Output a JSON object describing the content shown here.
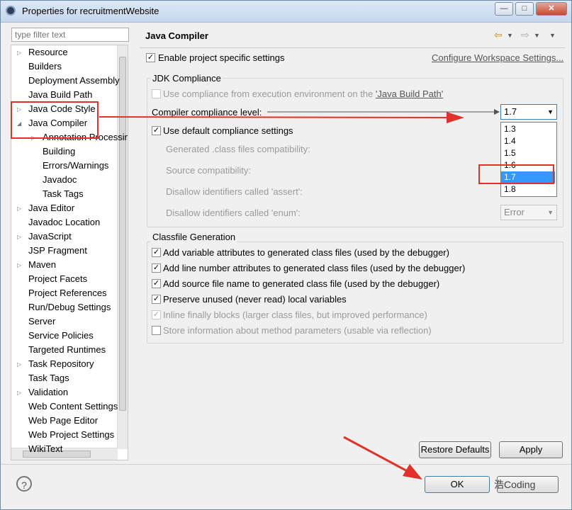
{
  "window": {
    "title": "Properties for recruitmentWebsite",
    "min": "—",
    "max": "□",
    "close": "✕"
  },
  "filter": {
    "placeholder": "type filter text"
  },
  "tree": [
    {
      "label": "Resource",
      "level": 0,
      "expander": "▷"
    },
    {
      "label": "Builders",
      "level": 0,
      "expander": ""
    },
    {
      "label": "Deployment Assembly",
      "level": 0,
      "expander": ""
    },
    {
      "label": "Java Build Path",
      "level": 0,
      "expander": ""
    },
    {
      "label": "Java Code Style",
      "level": 0,
      "expander": "▷"
    },
    {
      "label": "Java Compiler",
      "level": 0,
      "expander": "◢"
    },
    {
      "label": "Annotation Processing",
      "level": 1,
      "expander": "▷"
    },
    {
      "label": "Building",
      "level": 1,
      "expander": ""
    },
    {
      "label": "Errors/Warnings",
      "level": 1,
      "expander": ""
    },
    {
      "label": "Javadoc",
      "level": 1,
      "expander": ""
    },
    {
      "label": "Task Tags",
      "level": 1,
      "expander": ""
    },
    {
      "label": "Java Editor",
      "level": 0,
      "expander": "▷"
    },
    {
      "label": "Javadoc Location",
      "level": 0,
      "expander": ""
    },
    {
      "label": "JavaScript",
      "level": 0,
      "expander": "▷"
    },
    {
      "label": "JSP Fragment",
      "level": 0,
      "expander": ""
    },
    {
      "label": "Maven",
      "level": 0,
      "expander": "▷"
    },
    {
      "label": "Project Facets",
      "level": 0,
      "expander": ""
    },
    {
      "label": "Project References",
      "level": 0,
      "expander": ""
    },
    {
      "label": "Run/Debug Settings",
      "level": 0,
      "expander": ""
    },
    {
      "label": "Server",
      "level": 0,
      "expander": ""
    },
    {
      "label": "Service Policies",
      "level": 0,
      "expander": ""
    },
    {
      "label": "Targeted Runtimes",
      "level": 0,
      "expander": ""
    },
    {
      "label": "Task Repository",
      "level": 0,
      "expander": "▷"
    },
    {
      "label": "Task Tags",
      "level": 0,
      "expander": ""
    },
    {
      "label": "Validation",
      "level": 0,
      "expander": "▷"
    },
    {
      "label": "Web Content Settings",
      "level": 0,
      "expander": ""
    },
    {
      "label": "Web Page Editor",
      "level": 0,
      "expander": ""
    },
    {
      "label": "Web Project Settings",
      "level": 0,
      "expander": ""
    },
    {
      "label": "WikiText",
      "level": 0,
      "expander": ""
    }
  ],
  "page": {
    "title": "Java Compiler",
    "enable_specific": "Enable project specific settings",
    "configure_link": "Configure Workspace Settings...",
    "jdk_group": "JDK Compliance",
    "use_compliance": "Use compliance from execution environment on the ",
    "build_path_link": "'Java Build Path'",
    "compliance_label": "Compiler compliance level:",
    "compliance_value": "1.7",
    "use_default": "Use default compliance settings",
    "generated": "Generated .class files compatibility:",
    "source": "Source compatibility:",
    "assert": "Disallow identifiers called 'assert':",
    "enum": "Disallow identifiers called 'enum':",
    "enum_value": "Error",
    "versions": [
      "1.3",
      "1.4",
      "1.5",
      "1.6",
      "1.7",
      "1.8"
    ],
    "classfile_group": "Classfile Generation",
    "opt1": "Add variable attributes to generated class files (used by the debugger)",
    "opt2": "Add line number attributes to generated class files (used by the debugger)",
    "opt3": "Add source file name to generated class file (used by the debugger)",
    "opt4": "Preserve unused (never read) local variables",
    "opt5": "Inline finally blocks (larger class files, but improved performance)",
    "opt6": "Store information about method parameters (usable via reflection)",
    "restore": "Restore Defaults",
    "apply": "Apply"
  },
  "footer": {
    "ok": "OK",
    "help": "?",
    "watermark": "浩Coding"
  },
  "colors": {
    "annotation": "#e0322a",
    "selection": "#3399ff"
  }
}
